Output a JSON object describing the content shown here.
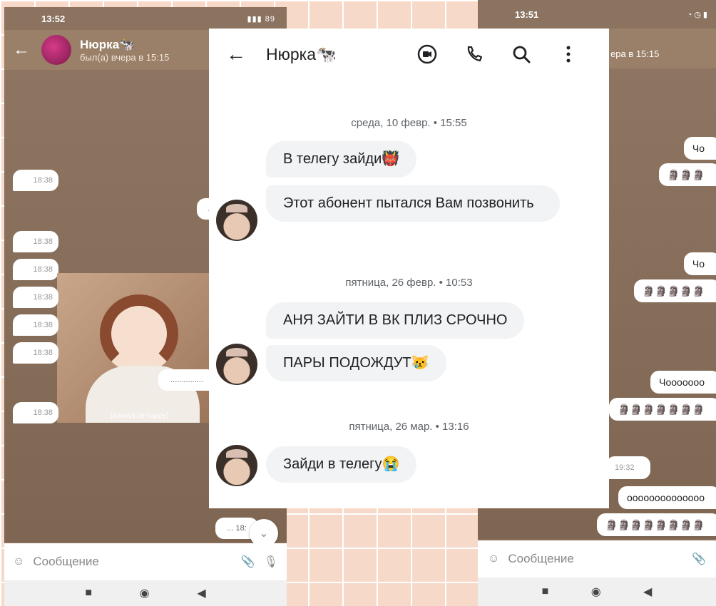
{
  "left_screen": {
    "status_time": "13:52",
    "status_battery": "89",
    "contact_name": "Нюрка🐄",
    "contact_status": "был(а) вчера в 15:15",
    "message_times": [
      "18:38",
      "18:38",
      "18:38",
      "18:38",
      "18:38",
      "18:38",
      "18:38",
      "18:38"
    ],
    "outgoing_dots": [
      "...",
      "..............."
    ],
    "outgoing_last": "... 18:",
    "image_caption": "[Always be happy]",
    "input_placeholder": "Сообщение"
  },
  "center_screen": {
    "contact_name": "Нюрка🐄",
    "conversations": [
      {
        "date": "среда, 10 февр. • 15:55",
        "messages": [
          "В телегу зайди👹",
          "Этот абонент пытался Вам позвонить"
        ]
      },
      {
        "date": "пятница, 26 февр. • 10:53",
        "messages": [
          "АНЯ ЗАЙТИ В ВК ПЛИЗ СРОЧНО",
          "ПАРЫ ПОДОЖДУТ😿"
        ]
      },
      {
        "date": "пятница, 26 мар. • 13:16",
        "messages": [
          "Зайди в телегу😭"
        ]
      }
    ]
  },
  "right_screen": {
    "status_time": "13:51",
    "contact_status": "ера в 15:15",
    "messages": [
      "Чо",
      "🗿🗿🗿",
      "Чо",
      "🗿🗿🗿🗿🗿",
      "Чоооoooo",
      "🗿🗿🗿🗿🗿🗿🗿",
      "оооооооооооооо",
      "🗿🗿🗿🗿🗿🗿🗿🗿"
    ],
    "incoming_time": "19:32",
    "input_placeholder": "Сообщение"
  }
}
